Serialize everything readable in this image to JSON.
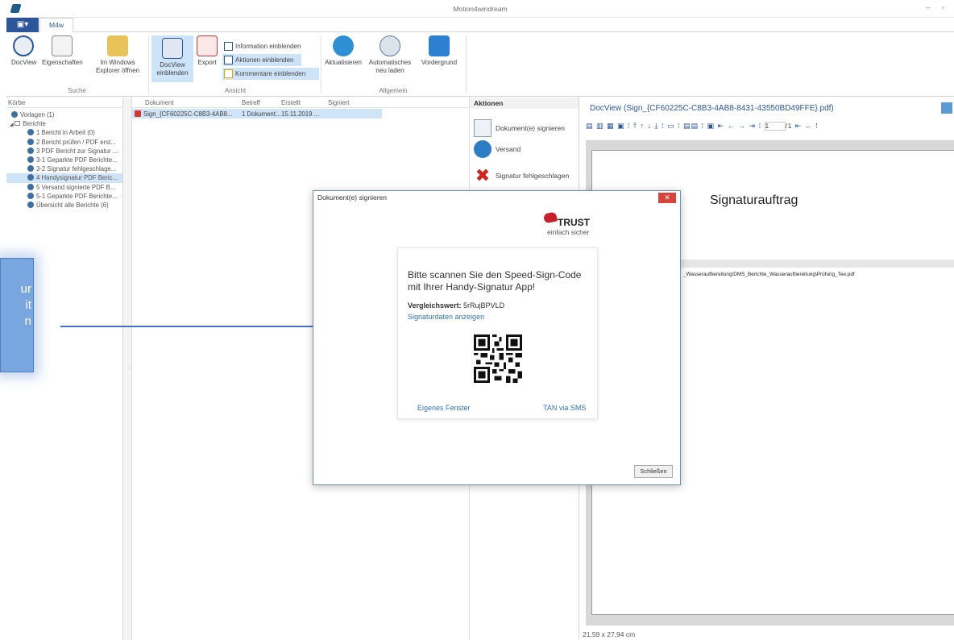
{
  "window": {
    "title": "Motion4windream"
  },
  "tabs": {
    "m4w": "M4w"
  },
  "ribbon": {
    "groups": {
      "suche": "Suche",
      "ansicht": "Ansicht",
      "allgemein": "Allgemein"
    },
    "buttons": {
      "docview": "DocView",
      "eigenschaften": "Eigenschaften",
      "explorer_line1": "Im Windows",
      "explorer_line2": "Explorer öffnen",
      "docview_einblenden_line1": "DocView",
      "docview_einblenden_line2": "einblenden",
      "export": "Export",
      "information": "Information einblenden",
      "aktionen": "Aktionen einblenden",
      "kommentare": "Kommentare einblenden",
      "aktualisieren": "Aktualisieren",
      "automatisches_line1": "Automatisches",
      "automatisches_line2": "neu laden",
      "vordergrund": "Vordergrund"
    }
  },
  "tree": {
    "header": "Körbe",
    "items": [
      {
        "label": "Vorlagen (1)"
      },
      {
        "label": "Berichte"
      },
      {
        "label": "1 Bericht in Arbeit (0)"
      },
      {
        "label": "2 Bericht prüfen / PDF erst..."
      },
      {
        "label": "3 PDF Bericht zur Signatur ..."
      },
      {
        "label": "3-1 Geparkte PDF Berichte..."
      },
      {
        "label": "3-2 Signatur fehlgeschlage..."
      },
      {
        "label": "4 Handysignatur PDF Beric..."
      },
      {
        "label": "5 Versand signierte PDF B..."
      },
      {
        "label": "5-1 Geparkte PDF Berichte..."
      },
      {
        "label": "Übersicht alle Berichte (6)"
      }
    ]
  },
  "doclist": {
    "columns": {
      "dokument": "Dokument",
      "betreff": "Betreff",
      "erstellt": "Erstellt",
      "signiert": "Signiert"
    },
    "row": {
      "dokument": "Sign_{CF60225C-C8B3-4AB8...",
      "betreff": "1 Dokument...",
      "erstellt": "15.11.2019 ..."
    }
  },
  "actions": {
    "header": "Aktionen",
    "items": [
      {
        "label": "Dokument(e) signieren"
      },
      {
        "label": "Versand"
      },
      {
        "label": "Signatur fehlgeschlagen"
      }
    ]
  },
  "docview": {
    "title": "DocView (Sign_{CF60225C-C8B3-4AB8-8431-43550BD49FFE}.pdf)",
    "page_field": "1",
    "page_total": "/1",
    "page_title": "Signaturauftrag",
    "page_path": "_Wasseraufbereitung\\DMS_Berichte_Wasseraufbereitung\\Prüfung_Tee.pdf",
    "status": "21,59 x 27,94 cm"
  },
  "callout": {
    "lines": [
      "ur",
      "it",
      "n"
    ]
  },
  "dialog": {
    "title": "Dokument(e) signieren",
    "logo_name": "TRUST",
    "logo_sub": "einfach sicher",
    "message": "Bitte scannen Sie den Speed-Sign-Code mit Ihrer Handy-Signatur App!",
    "compare_label": "Vergleichswert:",
    "compare_value": "5rRujBPVLD",
    "show_data": "Signaturdaten anzeigen",
    "own_window": "Eigenes Fenster",
    "tan_sms": "TAN via SMS",
    "close": "Schließen"
  }
}
